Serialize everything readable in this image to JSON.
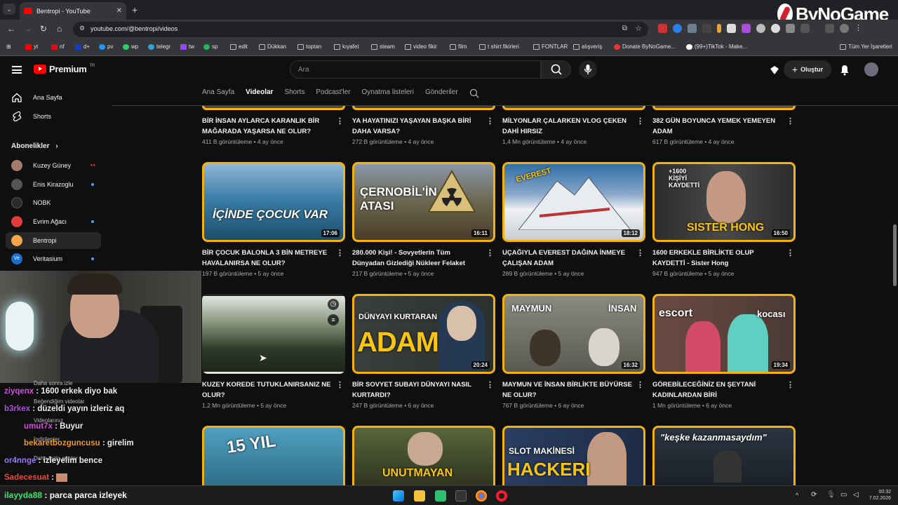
{
  "browser": {
    "tab_title": "Bentropi - YouTube",
    "url": "youtube.com/@bentropi/videos",
    "bookmarks": [
      "yt",
      "nf",
      "d+",
      "pv",
      "wp",
      "telegr",
      "tw",
      "sp",
      "edit",
      "Dükkan",
      "toptan",
      "kıyafet",
      "steam",
      "video fikir",
      "film",
      "t shirt fikirleri",
      "FONTLAR",
      "alışveriş",
      "Donate ByNoGame...",
      "(99+)TikTok - Make...",
      "Tüm Yer İşaretleri"
    ]
  },
  "watermark": "ByNoGame",
  "header": {
    "logo": "Premium",
    "logo_country": "TR",
    "search_placeholder": "Ara",
    "create_label": "Oluştur"
  },
  "sidebar": {
    "home": "Ana Sayfa",
    "shorts": "Shorts",
    "subs_heading": "Abonelikler",
    "channels": [
      {
        "name": "Kuzey Güney",
        "color": "#a37b6a",
        "live": true
      },
      {
        "name": "Enis Kirazoglu",
        "color": "#555555",
        "live": false
      },
      {
        "name": "NOBK",
        "color": "#2a2a2a",
        "live": false
      },
      {
        "name": "Evrim Ağacı",
        "color": "#e23c3c",
        "live": true
      },
      {
        "name": "Bentropi",
        "color": "#f5a54a",
        "live": false
      },
      {
        "name": "Veritasium",
        "color": "#1a6fc9",
        "live": true
      }
    ]
  },
  "channel_tabs": [
    "Ana Sayfa",
    "Videolar",
    "Shorts",
    "Podcast'ler",
    "Oynatma listeleri",
    "Gönderiler"
  ],
  "row1": [
    {
      "title": "BİR İNSAN AYLARCA KARANLIK BİR MAĞARADA YAŞARSA NE OLUR?",
      "views": "411 B görüntüleme",
      "age": "4 ay önce"
    },
    {
      "title": "YA HAYATINIZI YAŞAYAN BAŞKA BİRİ DAHA VARSA?",
      "views": "272 B görüntüleme",
      "age": "4 ay önce"
    },
    {
      "title": "MİLYONLAR ÇALARKEN VLOG ÇEKEN DAHİ HIRSIZ",
      "views": "1,4 Mn görüntüleme",
      "age": "4 ay önce"
    },
    {
      "title": "382 GÜN BOYUNCA YEMEK YEMEYEN ADAM",
      "views": "617 B görüntüleme",
      "age": "4 ay önce"
    }
  ],
  "row2": [
    {
      "title": "BİR ÇOCUK BALONLA 3 BİN METREYE HAVALANIRSA NE OLUR?",
      "views": "197 B görüntüleme",
      "age": "5 ay önce",
      "duration": "17:06",
      "thumb_text": "İÇİNDE ÇOCUK VAR",
      "bg": "#2d6a8f"
    },
    {
      "title": "280.000 Kişi! - Sovyetlerin Tüm Dünyadan Gizlediği Nükleer Felaket",
      "views": "217 B görüntüleme",
      "age": "5 ay önce",
      "duration": "16:11",
      "thumb_text": "ÇERNOBİL'İN ATASI",
      "bg": "#6b5a3e"
    },
    {
      "title": "UÇAĞIYLA EVEREST DAĞINA İNMEYE ÇALIŞAN ADAM",
      "views": "289 B görüntüleme",
      "age": "5 ay önce",
      "duration": "18:12",
      "thumb_text": "EVEREST",
      "bg": "#6b88a8"
    },
    {
      "title": "1600 ERKEKLE BİRLİKTE OLUP KAYDETTİ - Sister Hong",
      "views": "947 B görüntüleme",
      "age": "5 ay önce",
      "duration": "16:50",
      "thumb_text": "SISTER HONG",
      "thumb_small": "+1600 KİŞİYİ KAYDETTİ",
      "bg": "#3a3a3a"
    }
  ],
  "row3": [
    {
      "title": "KUZEY KOREDE TUTUKLANIRSANIZ NE OLUR?",
      "views": "1,2 Mn görüntüleme",
      "age": "5 ay önce",
      "duration": "",
      "bg": "#3d4a3a"
    },
    {
      "title": "BİR SOVYET SUBAYI DÜNYAYI NASIL KURTARDI?",
      "views": "247 B görüntüleme",
      "age": "6 ay önce",
      "duration": "20:24",
      "thumb_text": "ADAM",
      "thumb_small": "DÜNYAYI KURTARAN",
      "bg": "#2f3533"
    },
    {
      "title": "MAYMUN VE İNSAN BİRLİKTE BÜYÜRSE NE OLUR?",
      "views": "767 B görüntüleme",
      "age": "6 ay önce",
      "duration": "16:32",
      "thumb_text": "MAYMUN",
      "thumb_small": "İNSAN",
      "bg": "#5a5a52"
    },
    {
      "title": "GÖREBİLECEĞİNİZ EN ŞEYTANİ KADINLARDAN BİRİ",
      "views": "1 Mn görüntüleme",
      "age": "6 ay önce",
      "duration": "19:34",
      "thumb_text": "escort",
      "thumb_small": "kocası",
      "bg": "#5b3f3a"
    }
  ],
  "row4": [
    {
      "thumb_text": "15 YIL",
      "bg": "#2f6f8a"
    },
    {
      "thumb_text": "UNUTMAYAN",
      "bg": "#3a4029"
    },
    {
      "thumb_text": "HACKERI",
      "thumb_small": "SLOT MAKİNESİ",
      "bg": "#2a3e62"
    },
    {
      "thumb_text": "\"keşke kazanmasaydım\"",
      "bg": "#2b3440"
    }
  ],
  "chat": [
    {
      "user": "ziyqenx",
      "msg": "1600 erkek diyo bak",
      "color": "#d84de0"
    },
    {
      "user": "b3rkex",
      "msg": "düzeldi yayın izleriz aq",
      "color": "#b04de0"
    },
    {
      "user": "umut7x",
      "msg": "Buyur",
      "color": "#d84de0"
    },
    {
      "user": "bekaretbozguncusu",
      "msg": "girelim",
      "color": "#f39c12"
    },
    {
      "user": "or4nnge",
      "msg": "izleyelim bence",
      "color": "#9b7bff"
    },
    {
      "user": "Sadecesuat",
      "msg": "",
      "color": "#e74c3c"
    }
  ],
  "chat_ghost": [
    "Daha sonra izle",
    "Beğendiğim videolar",
    "Videolarınız",
    "İndirilenler",
    "Daha fazla göster"
  ],
  "last_chat": {
    "user": "ilayyda88",
    "msg": "parca parca izleyek",
    "color": "#3ee06f"
  },
  "clock": {
    "time": "00:32",
    "date": "7.02.2026"
  }
}
